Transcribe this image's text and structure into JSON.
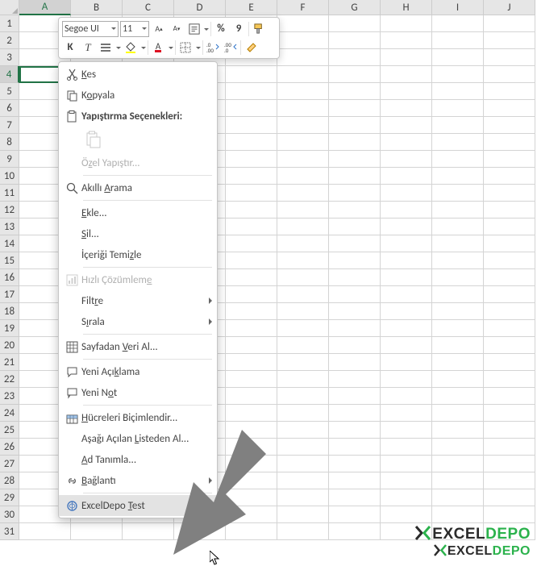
{
  "columns": [
    "A",
    "B",
    "C",
    "D",
    "E",
    "F",
    "G",
    "H",
    "I",
    "J"
  ],
  "rows_from": 1,
  "rows_to": 31,
  "selected_col": "A",
  "selected_row": 4,
  "mini_toolbar": {
    "font_name": "Segoe UI",
    "font_size": "11",
    "bold": "K",
    "italic": "T",
    "percent": "%",
    "thousands": "9"
  },
  "context_menu": {
    "cut": "Kes",
    "copy": "Kopyala",
    "paste_options_label": "Yapıştırma Seçenekleri:",
    "paste_special": "Özel Yapıştır...",
    "smart_lookup": "Akıllı Arama",
    "insert": "Ekle...",
    "delete": "Sil...",
    "clear_contents": "İçeriği Temizle",
    "quick_analysis": "Hızlı Çözümleme",
    "filter": "Filtre",
    "sort": "Sırala",
    "get_data_from_sheet": "Sayfadan Veri Al...",
    "new_comment": "Yeni Açıklama",
    "new_note": "Yeni Not",
    "format_cells": "Hücreleri Biçimlendir...",
    "pick_from_list": "Aşağı Açılan Listeden Al...",
    "define_name": "Ad Tanımla...",
    "link": "Bağlantı",
    "custom_item": "ExcelDepo Test"
  },
  "watermark": {
    "line1a": "EXCEL",
    "line1b": "DEPO"
  }
}
